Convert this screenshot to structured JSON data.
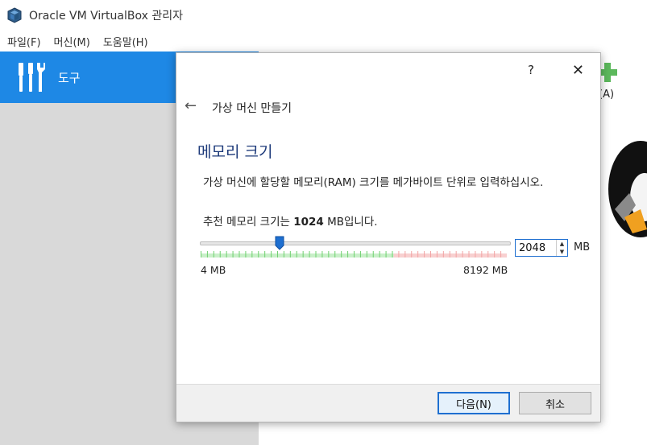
{
  "window": {
    "title": "Oracle VM VirtualBox 관리자"
  },
  "menubar": {
    "items": [
      "파일(F)",
      "머신(M)",
      "도움말(H)"
    ]
  },
  "sidebar": {
    "tools_label": "도구"
  },
  "main": {
    "add_label": "(A)"
  },
  "dialog": {
    "help": "?",
    "close": "✕",
    "back": "←",
    "wizard_title": "가상 머신 만들기",
    "section_title": "메모리 크기",
    "description": "가상 머신에 할당할 메모리(RAM) 크기를 메가바이트 단위로 입력하십시오.",
    "recommend_prefix": "추천 메모리 크기는 ",
    "recommend_value": "1024",
    "recommend_suffix": " MB입니다.",
    "slider": {
      "min_label": "4 MB",
      "max_label": "8192 MB",
      "min": 4,
      "max": 8192,
      "value": 2048,
      "green_fraction": 0.63
    },
    "spin_value": "2048",
    "unit": "MB",
    "next_label": "다음(N)",
    "cancel_label": "취소"
  },
  "colors": {
    "accent": "#1e88e5",
    "title": "#1d3a7a",
    "tick_green": "#6fd06f",
    "tick_red": "#f2a3a3"
  }
}
